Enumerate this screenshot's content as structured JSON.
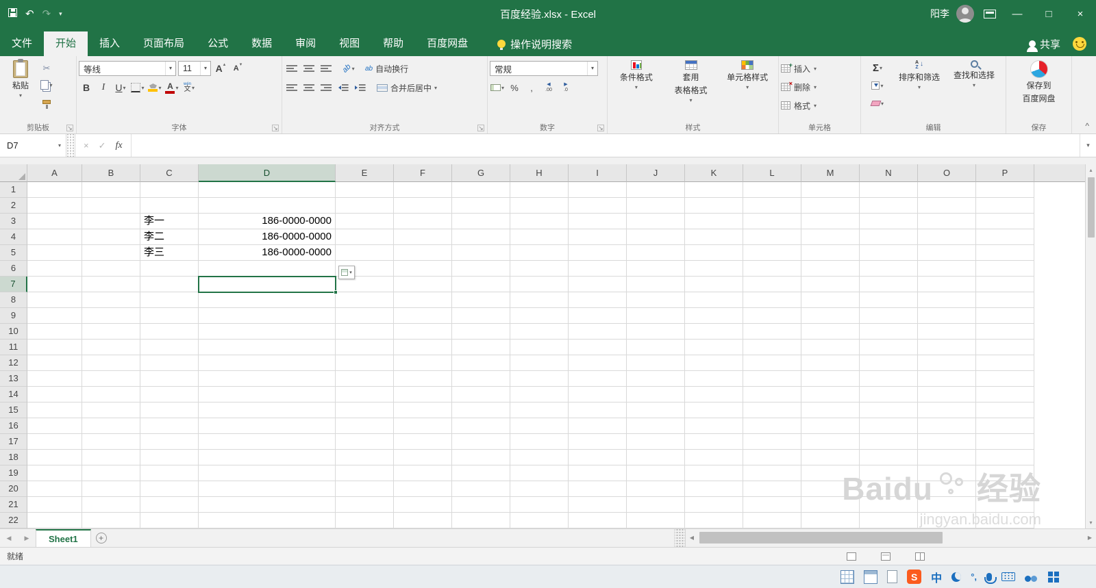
{
  "title_bar": {
    "title": "百度经验.xlsx - Excel",
    "user_name": "阳李"
  },
  "ribbon": {
    "tabs": [
      {
        "key": "file",
        "label": "文件",
        "active": false
      },
      {
        "key": "home",
        "label": "开始",
        "active": true
      },
      {
        "key": "insert",
        "label": "插入",
        "active": false
      },
      {
        "key": "page-layout",
        "label": "页面布局",
        "active": false
      },
      {
        "key": "formulas",
        "label": "公式",
        "active": false
      },
      {
        "key": "data",
        "label": "数据",
        "active": false
      },
      {
        "key": "review",
        "label": "审阅",
        "active": false
      },
      {
        "key": "view",
        "label": "视图",
        "active": false
      },
      {
        "key": "help",
        "label": "帮助",
        "active": false
      },
      {
        "key": "baidu-netdisk",
        "label": "百度网盘",
        "active": false
      }
    ],
    "tell_me": "操作说明搜索",
    "share_label": "共享",
    "groups": {
      "clipboard": {
        "label": "剪贴板",
        "paste_label": "粘贴"
      },
      "font": {
        "label": "字体",
        "font_name": "等线",
        "font_size": "11"
      },
      "alignment": {
        "label": "对齐方式",
        "wrap_label": "自动换行",
        "merge_label": "合并后居中"
      },
      "number": {
        "label": "数字",
        "format_value": "常规"
      },
      "styles": {
        "label": "样式",
        "conditional_label": "条件格式",
        "table_line1": "套用",
        "table_line2": "表格格式",
        "cell_styles_label": "单元格样式"
      },
      "cells": {
        "label": "单元格",
        "insert_label": "插入",
        "delete_label": "删除",
        "format_label": "格式"
      },
      "editing": {
        "label": "编辑",
        "sort_label": "排序和筛选",
        "find_label": "查找和选择"
      },
      "save": {
        "label": "保存",
        "line1": "保存到",
        "line2": "百度网盘"
      }
    }
  },
  "formula_bar": {
    "name_box": "D7",
    "fx_label": "fx",
    "formula_value": ""
  },
  "grid": {
    "columns": [
      "A",
      "B",
      "C",
      "D",
      "E",
      "F",
      "G",
      "H",
      "I",
      "J",
      "K",
      "L",
      "M",
      "N",
      "O",
      "P"
    ],
    "row_count": 22,
    "selected_cell": "D7",
    "cells": [
      {
        "ref": "C3",
        "text": "李一",
        "align": "left"
      },
      {
        "ref": "D3",
        "text": "186-0000-0000",
        "align": "right"
      },
      {
        "ref": "C4",
        "text": "李二",
        "align": "left"
      },
      {
        "ref": "D4",
        "text": "186-0000-0000",
        "align": "right"
      },
      {
        "ref": "C5",
        "text": "李三",
        "align": "left"
      },
      {
        "ref": "D5",
        "text": "186-0000-0000",
        "align": "right"
      }
    ]
  },
  "sheet_bar": {
    "sheets": [
      {
        "name": "Sheet1",
        "active": true
      }
    ]
  },
  "status_bar": {
    "status": "就绪"
  },
  "watermark": {
    "brand": "Baidu",
    "brand_cn": "经验",
    "url": "jingyan.baidu.com"
  },
  "glyphs": {
    "bold": "B",
    "italic": "I",
    "underline": "U",
    "font_increase": "A",
    "font_decrease": "A",
    "font_color_letter": "A",
    "phonetic": "文",
    "phonetic_pinyin": "wén",
    "wrap_ab": "ab",
    "orientation_ab": "ab",
    "sigma": "Σ",
    "percent": "%",
    "comma": ",",
    "decimal_increase": ".00",
    "decimal_decrease": ".0",
    "sort_a": "A",
    "sort_z": "Z",
    "sogou": "S",
    "ime_cn": "中",
    "ime_punct": "°,"
  },
  "colors": {
    "accent_green": "#217346",
    "fill_yellow": "#ffc000",
    "font_red": "#c00000"
  }
}
